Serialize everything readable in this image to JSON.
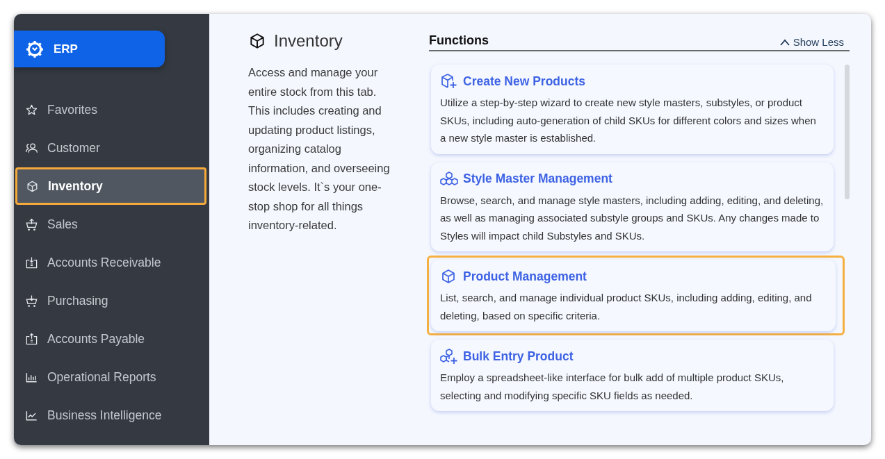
{
  "brand": {
    "label": "ERP"
  },
  "sidebar": {
    "items": [
      {
        "label": "Favorites",
        "selected": false
      },
      {
        "label": "Customer",
        "selected": false
      },
      {
        "label": "Inventory",
        "selected": true
      },
      {
        "label": "Sales",
        "selected": false
      },
      {
        "label": "Accounts Receivable",
        "selected": false
      },
      {
        "label": "Purchasing",
        "selected": false
      },
      {
        "label": "Accounts Payable",
        "selected": false
      },
      {
        "label": "Operational Reports",
        "selected": false
      },
      {
        "label": "Business Intelligence",
        "selected": false
      }
    ]
  },
  "section": {
    "title": "Inventory",
    "description": "Access and manage your entire stock from this tab. This includes creating and updating product listings, organizing catalog information, and overseeing stock levels. It`s your one-stop shop for all things inventory-related."
  },
  "functions": {
    "title": "Functions",
    "toggle": "Show Less",
    "cards": [
      {
        "title": "Create New Products",
        "description": "Utilize a step-by-step wizard to create new style masters, substyles, or product SKUs, including auto-generation of child SKUs for different colors and sizes when a new style master is established.",
        "selected": false
      },
      {
        "title": "Style Master Management",
        "description": "Browse, search, and manage style masters, including adding, editing, and deleting, as well as managing associated substyle groups and SKUs. Any changes made to Styles will impact child Substyles and SKUs.",
        "selected": false
      },
      {
        "title": "Product Management",
        "description": "List, search, and manage individual product SKUs, including adding, editing, and deleting, based on specific criteria.",
        "selected": true
      },
      {
        "title": "Bulk Entry Product",
        "description": "Employ a spreadsheet-like interface for bulk add of multiple product SKUs, selecting and modifying specific SKU fields as needed.",
        "selected": false
      }
    ]
  }
}
